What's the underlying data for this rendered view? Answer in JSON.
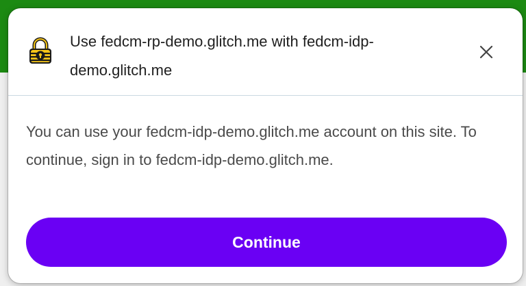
{
  "page": {
    "header_color": "#1c8a12"
  },
  "dialog": {
    "icon": "idp-lock-logo-icon",
    "title": "Use fedcm-rp-demo.glitch.me with fedcm-idp-demo.glitch.me",
    "close_icon": "close-icon",
    "body": "You can use your fedcm-idp-demo.glitch.me account on this site. To continue, sign in to fedcm-idp-demo.glitch.me.",
    "continue_label": "Continue",
    "accent_color": "#6a00f4"
  }
}
